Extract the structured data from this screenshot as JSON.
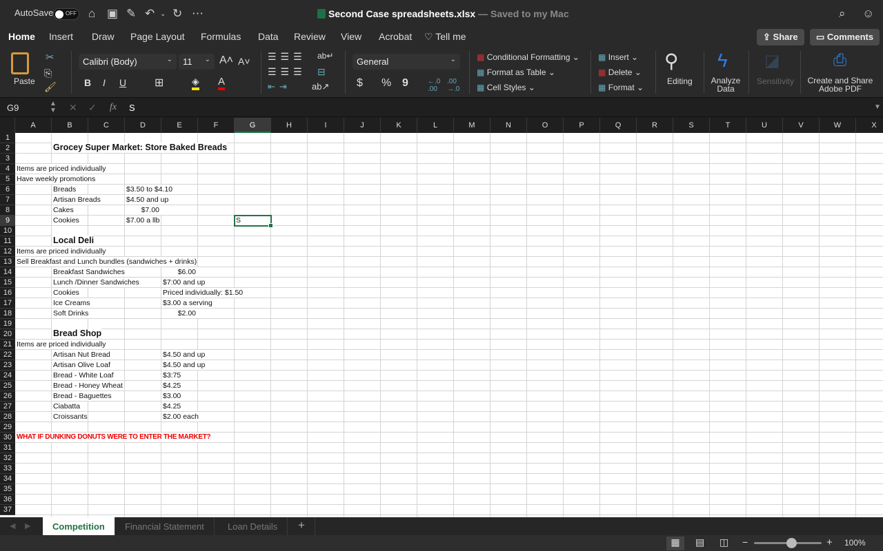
{
  "titlebar": {
    "autosave_label": "AutoSave",
    "autosave_state": "OFF",
    "file_name": "Second Case spreadsheets.xlsx",
    "save_status": "— Saved to my Mac"
  },
  "tabs": [
    "Home",
    "Insert",
    "Draw",
    "Page Layout",
    "Formulas",
    "Data",
    "Review",
    "View",
    "Acrobat"
  ],
  "tell_me": "Tell me",
  "share_label": "Share",
  "comments_label": "Comments",
  "ribbon": {
    "paste": "Paste",
    "font_name": "Calibri (Body)",
    "font_size": "11",
    "bold": "B",
    "italic": "I",
    "underline": "U",
    "number_format": "General",
    "currency": "$",
    "percent": "%",
    "comma": "9",
    "cond_format": "Conditional Formatting",
    "format_table": "Format as Table",
    "cell_styles": "Cell Styles",
    "insert": "Insert",
    "delete": "Delete",
    "format": "Format",
    "editing": "Editing",
    "analyze": "Analyze Data",
    "sensitivity": "Sensitivity",
    "adobe": "Create and Share Adobe PDF"
  },
  "formula_bar": {
    "name_box": "G9",
    "content": "S",
    "fx": "fx"
  },
  "columns": [
    "A",
    "B",
    "C",
    "D",
    "E",
    "F",
    "G",
    "H",
    "I",
    "J",
    "K",
    "L",
    "M",
    "N",
    "O",
    "P",
    "Q",
    "R",
    "S",
    "T",
    "U",
    "V",
    "W",
    "X"
  ],
  "selected_cell": {
    "col": "G",
    "row": 9
  },
  "cells": [
    {
      "r": 2,
      "c": 1,
      "t": "Grocey Super Market:  Store Baked Breads",
      "s": "title"
    },
    {
      "r": 4,
      "c": 0,
      "t": "Items are priced individually"
    },
    {
      "r": 5,
      "c": 0,
      "t": "Have weekly promotions"
    },
    {
      "r": 6,
      "c": 1,
      "t": "Breads"
    },
    {
      "r": 6,
      "c": 3,
      "t": "$3.50 to $4.10"
    },
    {
      "r": 7,
      "c": 1,
      "t": "Artisan Breads"
    },
    {
      "r": 7,
      "c": 3,
      "t": "$4.50 and up"
    },
    {
      "r": 8,
      "c": 1,
      "t": "Cakes"
    },
    {
      "r": 8,
      "c": 3,
      "t": "$7.00",
      "s": "right"
    },
    {
      "r": 9,
      "c": 1,
      "t": "Cookies"
    },
    {
      "r": 9,
      "c": 3,
      "t": "$7.00 a llb"
    },
    {
      "r": 9,
      "c": 6,
      "t": "S"
    },
    {
      "r": 11,
      "c": 1,
      "t": "Local Deli",
      "s": "title"
    },
    {
      "r": 12,
      "c": 0,
      "t": "Items are priced individually"
    },
    {
      "r": 13,
      "c": 0,
      "t": "Sell Breakfast and Lunch bundles (sandwiches + drinks)"
    },
    {
      "r": 14,
      "c": 1,
      "t": "Breakfast Sandwiches"
    },
    {
      "r": 14,
      "c": 4,
      "t": "$6.00",
      "s": "right"
    },
    {
      "r": 15,
      "c": 1,
      "t": "Lunch /Dinner Sandwiches"
    },
    {
      "r": 15,
      "c": 4,
      "t": "$7:00 and up"
    },
    {
      "r": 16,
      "c": 1,
      "t": "Cookies"
    },
    {
      "r": 16,
      "c": 4,
      "t": "Priced individually:  $1.50"
    },
    {
      "r": 17,
      "c": 1,
      "t": "Ice Creams"
    },
    {
      "r": 17,
      "c": 4,
      "t": "$3.00 a serving"
    },
    {
      "r": 18,
      "c": 1,
      "t": "Soft Drinks"
    },
    {
      "r": 18,
      "c": 4,
      "t": "$2.00",
      "s": "right"
    },
    {
      "r": 20,
      "c": 1,
      "t": "Bread Shop",
      "s": "title"
    },
    {
      "r": 21,
      "c": 0,
      "t": "Items are priced individually"
    },
    {
      "r": 22,
      "c": 1,
      "t": "Artisan Nut Bread"
    },
    {
      "r": 22,
      "c": 4,
      "t": "$4.50 and up"
    },
    {
      "r": 23,
      "c": 1,
      "t": "Artisan Olive Loaf"
    },
    {
      "r": 23,
      "c": 4,
      "t": "$4.50 and up"
    },
    {
      "r": 24,
      "c": 1,
      "t": "Bread - White Loaf"
    },
    {
      "r": 24,
      "c": 4,
      "t": "$3:75"
    },
    {
      "r": 25,
      "c": 1,
      "t": "Bread - Honey Wheat"
    },
    {
      "r": 25,
      "c": 4,
      "t": "$4.25"
    },
    {
      "r": 26,
      "c": 1,
      "t": "Bread - Baguettes"
    },
    {
      "r": 26,
      "c": 4,
      "t": "$3.00"
    },
    {
      "r": 27,
      "c": 1,
      "t": "Ciabatta"
    },
    {
      "r": 27,
      "c": 4,
      "t": "$4.25"
    },
    {
      "r": 28,
      "c": 1,
      "t": "Croissants"
    },
    {
      "r": 28,
      "c": 4,
      "t": "$2.00 each"
    },
    {
      "r": 30,
      "c": 0,
      "t": "WHAT IF DUNKING DONUTS WERE TO ENTER THE MARKET?",
      "s": "red"
    }
  ],
  "row_count": 37,
  "sheet_tabs": [
    "Competition",
    "Financial Statement",
    "Loan Details"
  ],
  "active_sheet": "Competition",
  "add_sheet": "+",
  "zoom": "100%",
  "zoom_percent": 100,
  "colors": {
    "accent": "#217346",
    "red_text": "#e00000"
  }
}
